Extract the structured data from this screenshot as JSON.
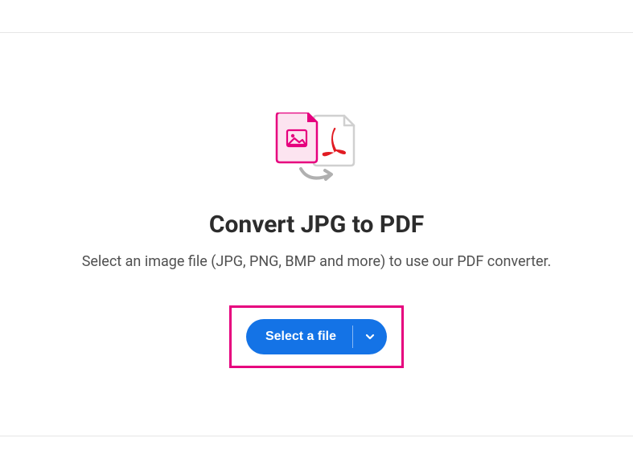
{
  "heading": "Convert JPG to PDF",
  "subtext": "Select an image file (JPG, PNG, BMP and more) to use our PDF converter.",
  "button": {
    "label": "Select a file"
  },
  "colors": {
    "primary": "#1473e6",
    "highlight": "#e6007e",
    "magenta": "#e6007e",
    "red": "#e11b22"
  }
}
